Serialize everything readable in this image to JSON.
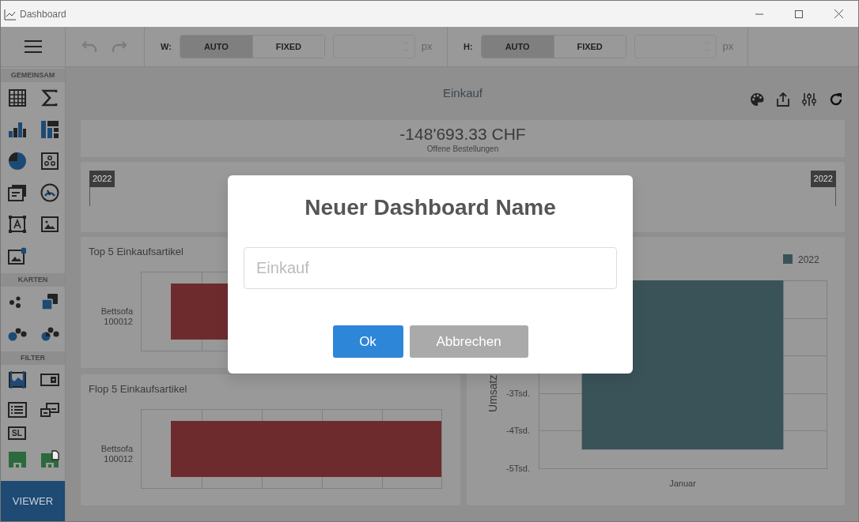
{
  "window": {
    "title": "Dashboard"
  },
  "toolbar": {
    "undo": {
      "disabled": true
    },
    "redo": {
      "disabled": true
    },
    "size_controls": [
      {
        "label": "W:",
        "options": [
          {
            "label": "AUTO",
            "selected": true
          },
          {
            "label": "FIXED",
            "selected": false
          }
        ],
        "unit": "px"
      },
      {
        "label": "H:",
        "options": [
          {
            "label": "AUTO",
            "selected": true
          },
          {
            "label": "FIXED",
            "selected": false
          }
        ],
        "unit": "px"
      }
    ]
  },
  "sidebar": {
    "sections": [
      {
        "title": "GEMEINSAM"
      },
      {
        "title": "KARTEN"
      },
      {
        "title": "FILTER",
        "text_icon": "SL"
      }
    ],
    "footer_button": {
      "label": "VIEWER"
    }
  },
  "dashboard": {
    "title": "Einkauf",
    "value_card": {
      "value": "-148'693.33 CHF",
      "caption": "Offene Bestellungen"
    },
    "range_filter": {
      "start": "2022",
      "end": "2022"
    },
    "top_chart": {
      "title": "Top 5 Einkaufsartikel",
      "category_label": [
        "Bettsofa",
        "100012"
      ]
    },
    "flop_chart": {
      "title": "Flop 5 Einkaufsartikel",
      "category_label": [
        "Bettsofa",
        "100012"
      ]
    },
    "monthly_chart": {
      "chart_data": {
        "type": "bar",
        "ylabel": "Umsatz",
        "categories": [
          "Januar"
        ],
        "series": [
          {
            "name": "2022",
            "color": "#3a5359",
            "values": [
              -4.5
            ]
          }
        ],
        "ylim": [
          -5,
          0
        ],
        "yticks": [
          {
            "value": -3,
            "label": "-3Tsd."
          },
          {
            "value": -4,
            "label": "-4Tsd."
          },
          {
            "value": -5,
            "label": "-5Tsd."
          }
        ]
      }
    }
  },
  "dialog": {
    "title": "Neuer Dashboard Name",
    "input": {
      "placeholder": "Einkauf"
    },
    "buttons": [
      {
        "label": "Ok",
        "kind": "primary"
      },
      {
        "label": "Abbrechen",
        "kind": "secondary"
      }
    ]
  }
}
